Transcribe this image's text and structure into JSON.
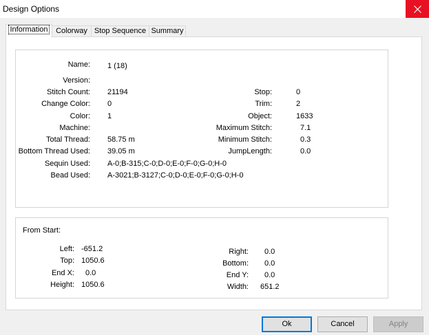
{
  "window": {
    "title": "Design Options"
  },
  "tabs": [
    "Information",
    "Colorway",
    "Stop Sequence",
    "Summary"
  ],
  "info": {
    "name_label": "Name:",
    "name_value": "1 (18)",
    "version_label": "Version:",
    "version_value": "",
    "stitch_count_label": "Stitch Count:",
    "stitch_count_value": "21194",
    "change_color_label": "Change Color:",
    "change_color_value": "0",
    "color_label": "Color:",
    "color_value": "1",
    "machine_label": "Machine:",
    "machine_value": "",
    "total_thread_label": "Total Thread:",
    "total_thread_value": "58.75 m",
    "bottom_thread_label": "Bottom Thread Used:",
    "bottom_thread_value": "39.05 m",
    "sequin_label": "Sequin Used:",
    "sequin_value": "A-0;B-315;C-0;D-0;E-0;F-0;G-0;H-0",
    "bead_label": "Bead Used:",
    "bead_value": "A-3021;B-3127;C-0;D-0;E-0;F-0;G-0;H-0",
    "stop_label": "Stop:",
    "stop_value": "0",
    "trim_label": "Trim:",
    "trim_value": "2",
    "object_label": "Object:",
    "object_value": "1633",
    "max_stitch_label": "Maximum Stitch:",
    "max_stitch_value": "7.1",
    "min_stitch_label": "Minimum Stitch:",
    "min_stitch_value": "0.3",
    "jump_length_label": "JumpLength:",
    "jump_length_value": "0.0"
  },
  "from_start": {
    "heading": "From Start:",
    "left_label": "Left:",
    "left_value": "-651.2",
    "top_label": "Top:",
    "top_value": "1050.6",
    "endx_label": "End X:",
    "endx_value": "0.0",
    "height_label": "Height:",
    "height_value": "1050.6",
    "right_label": "Right:",
    "right_value": "0.0",
    "bottom_label": "Bottom:",
    "bottom_value": "0.0",
    "endy_label": "End Y:",
    "endy_value": "0.0",
    "width_label": "Width:",
    "width_value": "651.2"
  },
  "buttons": {
    "ok": "Ok",
    "cancel": "Cancel",
    "apply": "Apply"
  },
  "colors": {
    "close_bg": "#e81123",
    "default_border": "#0078d7"
  }
}
